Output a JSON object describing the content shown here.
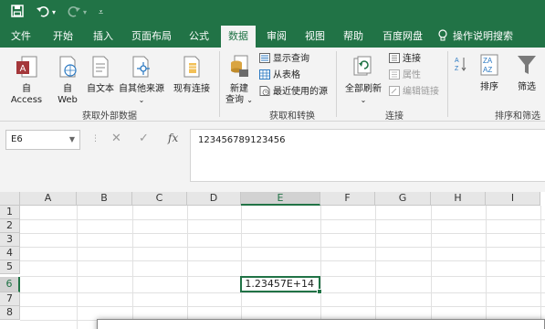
{
  "quick_access": {
    "save_icon": "save-icon",
    "undo_icon": "undo-icon",
    "redo_icon": "redo-icon",
    "customize_icon": "customize-qat-icon"
  },
  "tabs": [
    {
      "label": "文件"
    },
    {
      "label": "开始"
    },
    {
      "label": "插入"
    },
    {
      "label": "页面布局"
    },
    {
      "label": "公式"
    },
    {
      "label": "数据"
    },
    {
      "label": "审阅"
    },
    {
      "label": "视图"
    },
    {
      "label": "帮助"
    },
    {
      "label": "百度网盘"
    },
    {
      "label": "操作说明搜索"
    }
  ],
  "ribbon": {
    "get_external": {
      "access": "自 Access",
      "web_line1": "自",
      "web_line2": "Web",
      "text": "自文本",
      "other": "自其他来源",
      "existing": "现有连接",
      "group_label": "获取外部数据"
    },
    "get_transform": {
      "new_query_line1": "新建",
      "new_query_line2": "查询",
      "show_queries": "显示查询",
      "from_table": "从表格",
      "recent_sources": "最近使用的源",
      "group_label": "获取和转换"
    },
    "connections": {
      "refresh_all": "全部刷新",
      "connections": "连接",
      "properties": "属性",
      "edit_links": "编辑链接",
      "group_label": "连接"
    },
    "sort_filter": {
      "sort": "排序",
      "filter": "筛选",
      "group_label": "排序和筛选"
    }
  },
  "formula_bar": {
    "name_box": "E6",
    "cancel": "✕",
    "enter": "✓",
    "fx": "fx",
    "value": "123456789123456"
  },
  "grid": {
    "columns": [
      "A",
      "B",
      "C",
      "D",
      "E",
      "F",
      "G",
      "H",
      "I"
    ],
    "rows": [
      "1",
      "2",
      "3",
      "4",
      "5",
      "6",
      "7",
      "8"
    ],
    "active_cell_display": "1.23457E+14"
  },
  "colors": {
    "accent": "#217346"
  }
}
